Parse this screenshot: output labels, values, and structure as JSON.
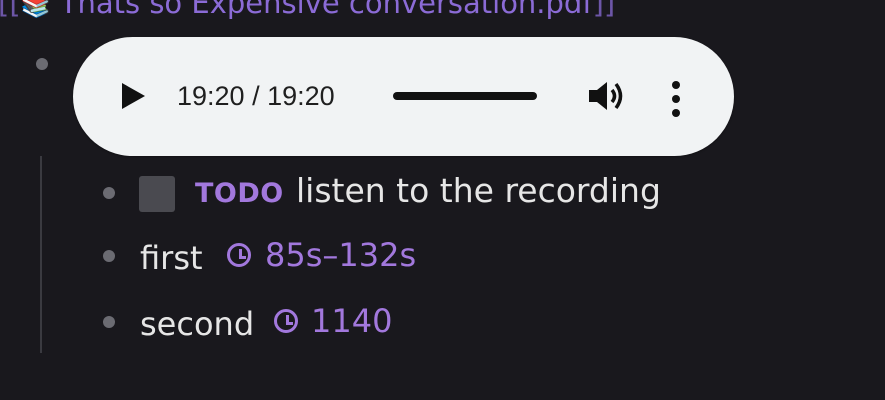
{
  "page_link": {
    "open": "[[",
    "emoji": "📚",
    "title": "Thats so Expensive conversation.pdf",
    "close": "]]"
  },
  "audio_player": {
    "time_display": "19:20 / 19:20",
    "progress_fraction": 1.0
  },
  "blocks": [
    {
      "marker": "TODO",
      "text": "listen to the recording"
    },
    {
      "text": "first",
      "timestamp": "85s–132s"
    },
    {
      "text": "second",
      "timestamp": "1140"
    }
  ]
}
